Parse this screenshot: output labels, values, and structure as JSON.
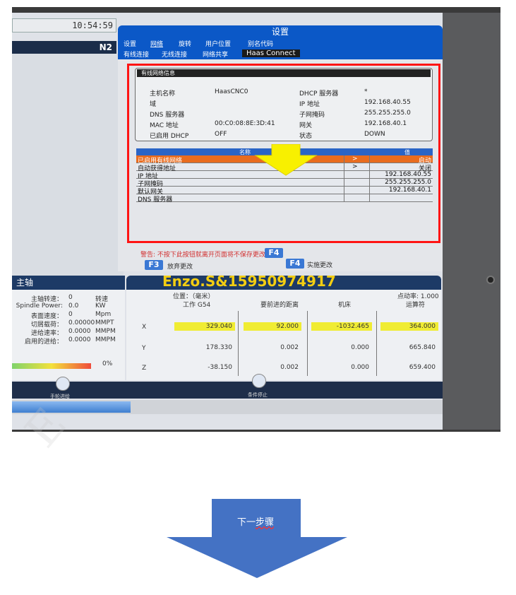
{
  "left_column": {
    "clock": "10:54:59",
    "mode": "N2"
  },
  "spindle": {
    "title": "主轴",
    "rows": [
      {
        "label": "主轴转速：",
        "value": "0",
        "unit": "转速"
      },
      {
        "label": "Spindle Power:",
        "value": "0.0",
        "unit": "KW"
      },
      {
        "label": "表面速度：",
        "value": "0",
        "unit": "Mpm"
      },
      {
        "label": "切屑载荷：",
        "value": "0.00000",
        "unit": "MMPT"
      },
      {
        "label": "进给速率：",
        "value": "0.0000",
        "unit": "MMPM"
      },
      {
        "label": "启用的进给：",
        "value": "0.0000",
        "unit": "MMPM"
      }
    ],
    "load_percent": "0%"
  },
  "window": {
    "title": "设置",
    "tabs_primary": [
      "设置",
      "网络",
      "旋转",
      "用户位置",
      "别名代码"
    ],
    "tabs_secondary": [
      "有线连接",
      "无线连接",
      "网络共享",
      "Haas Connect"
    ]
  },
  "wired_info": {
    "title": "有线网络信息",
    "left_fields": [
      {
        "label": "主机名称",
        "value": "HaasCNC0"
      },
      {
        "label": "域",
        "value": ""
      },
      {
        "label": "DNS 服务器",
        "value": ""
      },
      {
        "label": "MAC 地址",
        "value": "00:C0:08:8E:3D:41"
      },
      {
        "label": "已启用 DHCP",
        "value": "OFF"
      }
    ],
    "right_fields": [
      {
        "label": "DHCP 服务器",
        "value": "*"
      },
      {
        "label": "IP 地址",
        "value": "192.168.40.55"
      },
      {
        "label": "子网掩码",
        "value": "255.255.255.0"
      },
      {
        "label": "网关",
        "value": "192.168.40.1"
      },
      {
        "label": "状态",
        "value": "DOWN"
      }
    ]
  },
  "settings_table": {
    "col_name": "名称",
    "col_value": "值",
    "rows": [
      {
        "name": "已启用有线网络",
        "marker": ">",
        "value": "启动"
      },
      {
        "name": "自动获得地址",
        "marker": ">",
        "value": "关闭"
      },
      {
        "name": "IP 地址",
        "marker": "",
        "value": "192.168.40.55"
      },
      {
        "name": "子网掩码",
        "marker": "",
        "value": "255.255.255.0"
      },
      {
        "name": "默认网关",
        "marker": "",
        "value": "192.168.40.1"
      },
      {
        "name": "DNS 服务器",
        "marker": "",
        "value": ""
      }
    ]
  },
  "footer": {
    "warning": "警告: 不按下此按钮就离开页面将不保存更改",
    "f4_key": "F4",
    "f3_key": "F3",
    "f3_label": "放弃更改",
    "f4_apply_key": "F4",
    "f4_apply_label": "实施更改"
  },
  "position": {
    "header": "位置：（毫米）",
    "subheader": "工作 G54",
    "rapid": "点动率: 1.000",
    "col_distance": "要前进的距离",
    "col_machine": "机床",
    "col_operator": "运算符",
    "axes": [
      {
        "axis": "X",
        "work": "329.040",
        "dist": "92.000",
        "machine": "-1032.465",
        "operator": "364.000"
      },
      {
        "axis": "Y",
        "work": "178.330",
        "dist": "0.002",
        "machine": "0.000",
        "operator": "665.840"
      },
      {
        "axis": "Z",
        "work": "-38.150",
        "dist": "0.002",
        "machine": "0.000",
        "operator": "659.400"
      }
    ]
  },
  "watermark_text": "Enzo.S&15950974917",
  "bottom_buttons": {
    "left_label": "手轮进给",
    "right_label": "条件停止"
  },
  "next_step": {
    "label_prefix": "下一",
    "label_suffix": "步骤"
  },
  "colors": {
    "screen_blue": "#0b58c7",
    "highlight_yellow": "#f0ec32",
    "selected_row_orange": "#e86c1f",
    "annotation_red": "#ff1414",
    "arrow_blue": "#4472c4"
  }
}
